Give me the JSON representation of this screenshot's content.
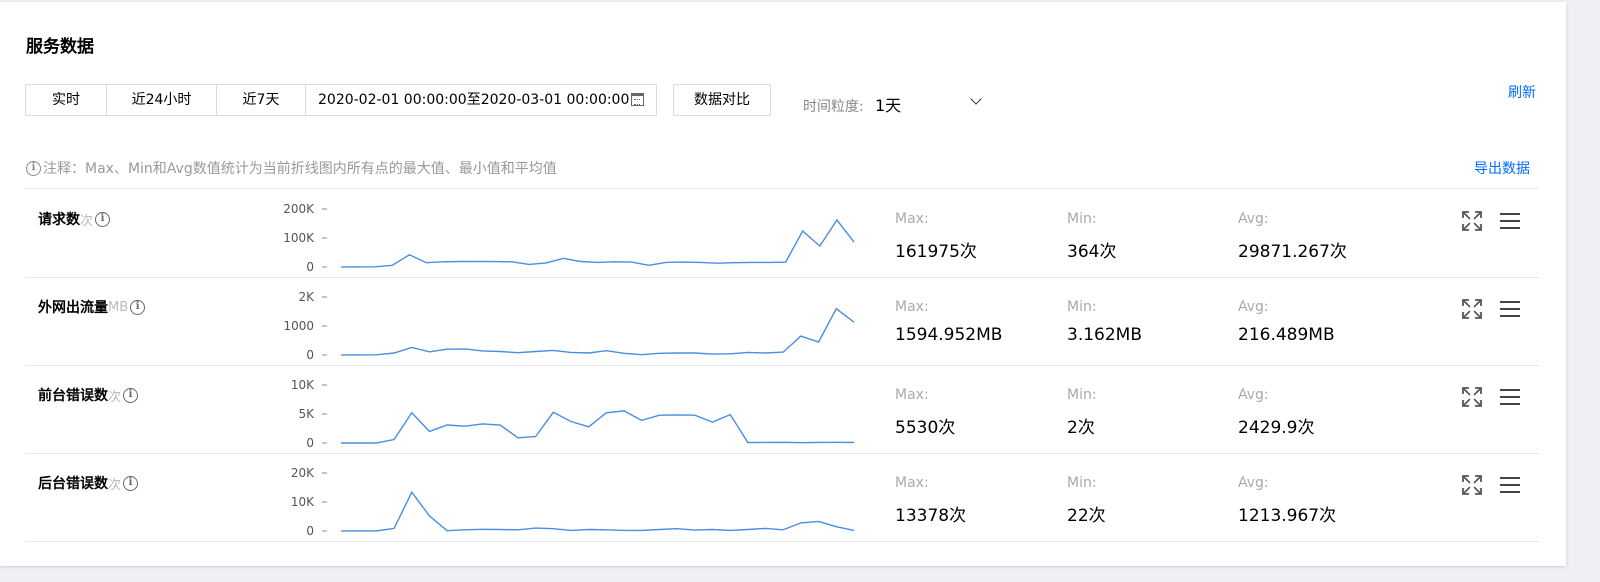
{
  "header": {
    "title": "服务数据"
  },
  "toolbar": {
    "tabs": [
      "实时",
      "近24小时",
      "近7天"
    ],
    "range": "2020-02-01 00:00:00至2020-03-01 00:00:00",
    "compare_label": "数据对比",
    "granularity_label": "时间粒度:",
    "granularity_value": "1天",
    "refresh_label": "刷新"
  },
  "note": {
    "text": "注释：Max、Min和Avg数值统计为当前折线图内所有点的最大值、最小值和平均值",
    "export_label": "导出数据"
  },
  "stat_labels": {
    "max": "Max:",
    "min": "Min:",
    "avg": "Avg:"
  },
  "colors": {
    "accent": "#006eff",
    "line": "#4a8ee0"
  },
  "icons": [
    "info-icon",
    "calendar-icon",
    "chevron-down-icon",
    "expand-icon",
    "menu-icon"
  ],
  "chart_data": [
    {
      "type": "line",
      "name": "请求数",
      "unit": "次",
      "y_ticks": [
        "200K",
        "100K",
        "0"
      ],
      "ylim": [
        0,
        200000
      ],
      "values": [
        500,
        500,
        600,
        6000,
        42000,
        15000,
        18000,
        19000,
        19000,
        18500,
        18000,
        9000,
        14000,
        30000,
        19000,
        16000,
        18000,
        17000,
        6000,
        16000,
        17000,
        16000,
        13000,
        15000,
        16000,
        16000,
        16500,
        124000,
        72000,
        161975,
        86000
      ],
      "stats": {
        "max": "161975次",
        "min": "364次",
        "avg": "29871.267次"
      }
    },
    {
      "type": "line",
      "name": "外网出流量",
      "unit": "MB",
      "y_ticks": [
        "2K",
        "1000",
        "0"
      ],
      "ylim": [
        0,
        2000
      ],
      "values": [
        3.2,
        3.2,
        8,
        70,
        260,
        110,
        200,
        210,
        140,
        120,
        80,
        120,
        160,
        90,
        70,
        150,
        60,
        10,
        60,
        70,
        70,
        30,
        40,
        90,
        70,
        100,
        650,
        450,
        1594.952,
        1130
      ],
      "stats": {
        "max": "1594.952MB",
        "min": "3.162MB",
        "avg": "216.489MB"
      }
    },
    {
      "type": "line",
      "name": "前台错误数",
      "unit": "次",
      "y_ticks": [
        "10K",
        "5K",
        "0"
      ],
      "ylim": [
        0,
        10000
      ],
      "values": [
        2,
        2,
        5,
        600,
        5200,
        2000,
        3100,
        2900,
        3300,
        3100,
        900,
        1100,
        5300,
        3700,
        2800,
        5200,
        5530,
        3900,
        4800,
        4850,
        4800,
        3600,
        4900,
        80,
        100,
        120,
        60,
        100,
        120,
        80
      ],
      "stats": {
        "max": "5530次",
        "min": "2次",
        "avg": "2429.9次"
      }
    },
    {
      "type": "line",
      "name": "后台错误数",
      "unit": "次",
      "y_ticks": [
        "20K",
        "10K",
        "0"
      ],
      "ylim": [
        0,
        20000
      ],
      "values": [
        22,
        22,
        50,
        900,
        13378,
        5200,
        100,
        400,
        600,
        500,
        400,
        1000,
        800,
        200,
        500,
        400,
        200,
        200,
        500,
        800,
        300,
        500,
        200,
        500,
        900,
        400,
        2800,
        3300,
        1500,
        200
      ],
      "stats": {
        "max": "13378次",
        "min": "22次",
        "avg": "1213.967次"
      }
    }
  ]
}
